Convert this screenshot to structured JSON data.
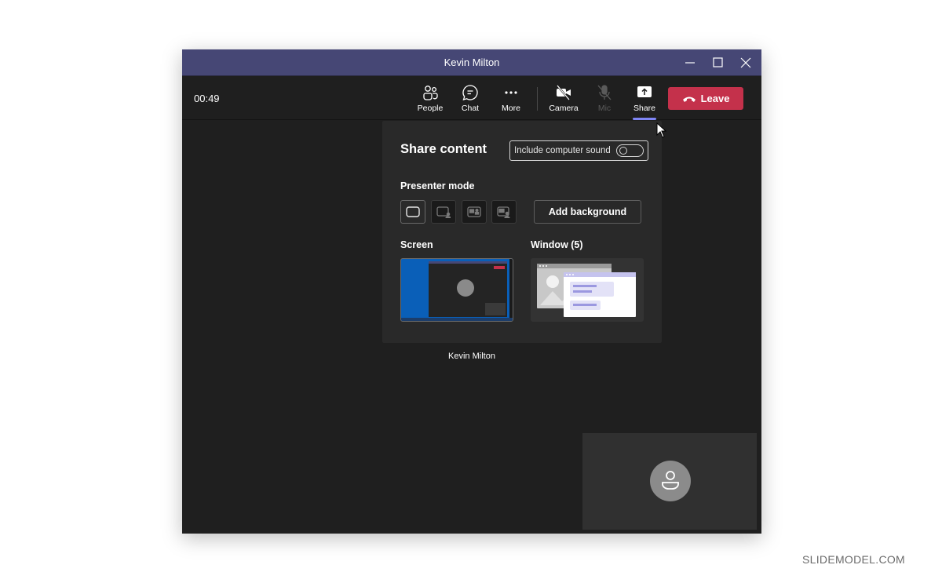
{
  "window": {
    "title": "Kevin Milton",
    "controls": {
      "minimize": "minimize-icon",
      "maximize": "maximize-icon",
      "close": "close-icon"
    }
  },
  "toolbar": {
    "timer": "00:49",
    "buttons": [
      {
        "label": "People",
        "icon": "people-icon",
        "enabled": true
      },
      {
        "label": "Chat",
        "icon": "chat-icon",
        "enabled": true
      },
      {
        "label": "More",
        "icon": "more-icon",
        "enabled": true
      },
      {
        "label": "Camera",
        "icon": "camera-off-icon",
        "enabled": true
      },
      {
        "label": "Mic",
        "icon": "mic-off-icon",
        "enabled": false
      },
      {
        "label": "Share",
        "icon": "share-icon",
        "enabled": true,
        "active": true
      }
    ],
    "leave_label": "Leave",
    "leave_color": "#c4314b",
    "accent": "#7f85f5"
  },
  "share_panel": {
    "title": "Share content",
    "sound_toggle_label": "Include computer sound",
    "sound_toggle_on": false,
    "presenter_mode_label": "Presenter mode",
    "presenter_modes": [
      {
        "name": "content-only",
        "selected": true
      },
      {
        "name": "standout",
        "selected": false
      },
      {
        "name": "side-by-side",
        "selected": false
      },
      {
        "name": "reporter",
        "selected": false
      }
    ],
    "add_background_label": "Add background",
    "screen_label": "Screen",
    "window_label": "Window (5)"
  },
  "stage": {
    "participant_name": "Kevin Milton"
  },
  "brand_color": "#464775",
  "watermark": "SLIDEMODEL.COM"
}
